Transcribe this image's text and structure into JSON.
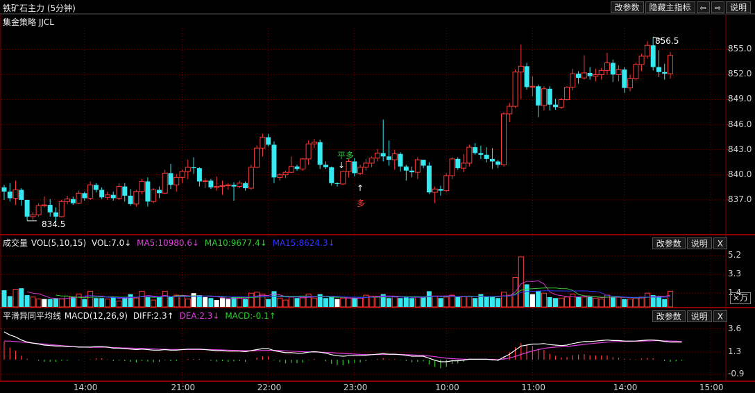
{
  "header": {
    "title": "铁矿石主力 (5分钟)",
    "buttons": {
      "params": "改参数",
      "hide_main": "隐藏主指标",
      "prev": "⇦",
      "next": "⇨",
      "help": "说明"
    }
  },
  "strategy": {
    "label": "集金策略 JJCL"
  },
  "colors": {
    "up": "#ff3b3b",
    "down": "#36e8f0",
    "grid": "#7a0000",
    "ma5": "#ffffff",
    "ma10": "#ffd700",
    "ma15": "#cc33cc",
    "ma_vol10": "#33cc33",
    "ma_vol15": "#3333ff"
  },
  "price_axis": {
    "ticks": [
      "855.0",
      "852.0",
      "849.0",
      "846.0",
      "843.0",
      "840.0",
      "837.0"
    ],
    "tick_values": [
      855,
      852,
      849,
      846,
      843,
      840,
      837
    ],
    "range": [
      833.0,
      857.6
    ]
  },
  "annotations": {
    "high": "856.5",
    "low": "834.5",
    "close_long": "平多",
    "long": "多",
    "arrow_down": "↓",
    "arrow_up": "↑"
  },
  "volume_panel": {
    "title": "成交量",
    "label": "VOL(5,10,15)",
    "vol": "VOL:7.0↓",
    "ma5": "MA5:10980.6↓",
    "ma10": "MA10:9677.4↓",
    "ma15": "MA15:8624.3↓",
    "buttons": {
      "params": "改参数",
      "help": "说明",
      "close": "X"
    },
    "ticks": [
      "5.2",
      "3.3",
      "1.4"
    ],
    "tick_values": [
      5.2,
      3.3,
      1.4
    ],
    "range": [
      0,
      5.8
    ],
    "unit": "×万"
  },
  "macd_panel": {
    "title": "平滑异同平均线",
    "label": "MACD(12,26,9)",
    "diff": "DIFF:2.3↑",
    "dea": "DEA:2.3↓",
    "macd": "MACD:-0.1↑",
    "buttons": {
      "params": "改参数",
      "help": "说明",
      "close": "X"
    },
    "ticks": [
      "3.6",
      "1.3",
      "-0.9"
    ],
    "tick_values": [
      3.6,
      1.3,
      -0.9
    ],
    "range": [
      -1.5,
      4.4
    ]
  },
  "time_axis": {
    "labels": [
      "14:00",
      "21:00",
      "22:00",
      "23:00",
      "10:00",
      "11:00",
      "14:00",
      "15:00"
    ],
    "label_index": [
      14,
      31,
      46,
      61,
      77,
      92,
      108,
      123
    ]
  },
  "chart_data": {
    "type": "candlestick",
    "candles": [
      [
        838.5,
        838.8,
        837.0,
        838.0
      ],
      [
        838.0,
        839.0,
        836.8,
        837.2
      ],
      [
        837.2,
        839.3,
        836.4,
        838.2
      ],
      [
        838.2,
        838.4,
        836.3,
        837.0
      ],
      [
        837.0,
        837.0,
        834.5,
        835.0
      ],
      [
        835.0,
        835.5,
        834.6,
        835.2
      ],
      [
        835.2,
        836.6,
        835.0,
        836.3
      ],
      [
        836.3,
        837.4,
        836.1,
        836.4
      ],
      [
        836.4,
        837.1,
        835.0,
        835.5
      ],
      [
        835.5,
        836.1,
        834.5,
        835.0
      ],
      [
        835.0,
        837.0,
        834.9,
        836.8
      ],
      [
        836.8,
        837.5,
        836.5,
        837.1
      ],
      [
        837.1,
        837.4,
        836.4,
        836.6
      ],
      [
        836.6,
        838.1,
        836.5,
        837.8
      ],
      [
        837.8,
        838.0,
        836.9,
        837.2
      ],
      [
        837.2,
        839.2,
        837.0,
        838.8
      ],
      [
        838.8,
        839.0,
        837.9,
        838.2
      ],
      [
        838.2,
        838.5,
        837.1,
        837.3
      ],
      [
        837.3,
        838.0,
        837.0,
        837.6
      ],
      [
        837.6,
        838.0,
        836.9,
        837.2
      ],
      [
        837.2,
        839.0,
        837.0,
        838.6
      ],
      [
        838.6,
        839.0,
        836.8,
        837.5
      ],
      [
        837.5,
        838.3,
        836.3,
        836.5
      ],
      [
        836.5,
        838.2,
        836.2,
        838.0
      ],
      [
        838.0,
        839.5,
        837.7,
        839.2
      ],
      [
        839.2,
        839.7,
        836.2,
        836.8
      ],
      [
        836.8,
        838.4,
        836.6,
        838.2
      ],
      [
        838.2,
        838.6,
        837.2,
        837.8
      ],
      [
        837.8,
        840.6,
        837.8,
        840.2
      ],
      [
        840.2,
        841.3,
        838.3,
        838.8
      ],
      [
        838.8,
        840.1,
        838.0,
        839.7
      ],
      [
        839.7,
        840.6,
        839.0,
        840.4
      ],
      [
        840.4,
        841.8,
        839.5,
        840.9
      ],
      [
        840.9,
        842.1,
        840.1,
        840.8
      ],
      [
        840.8,
        840.9,
        838.6,
        839.2
      ],
      [
        839.2,
        839.6,
        838.4,
        839.3
      ],
      [
        839.3,
        839.5,
        838.3,
        838.5
      ],
      [
        838.5,
        839.8,
        838.1,
        838.6
      ],
      [
        838.6,
        839.3,
        837.6,
        838.7
      ],
      [
        838.7,
        839.0,
        838.2,
        838.8
      ],
      [
        838.8,
        839.1,
        836.9,
        838.6
      ],
      [
        838.6,
        839.3,
        838.4,
        839.0
      ],
      [
        839.0,
        839.2,
        838.1,
        838.4
      ],
      [
        838.4,
        841.2,
        838.2,
        840.9
      ],
      [
        840.9,
        843.5,
        840.8,
        843.2
      ],
      [
        843.2,
        844.9,
        842.2,
        844.5
      ],
      [
        844.5,
        844.9,
        843.4,
        843.6
      ],
      [
        843.6,
        844.0,
        839.0,
        839.7
      ],
      [
        839.7,
        840.2,
        839.3,
        840.0
      ],
      [
        840.0,
        840.5,
        839.6,
        840.3
      ],
      [
        840.3,
        842.2,
        840.2,
        841.0
      ],
      [
        841.0,
        841.2,
        840.5,
        840.7
      ],
      [
        840.7,
        842.0,
        840.5,
        841.9
      ],
      [
        841.9,
        844.1,
        841.2,
        843.7
      ],
      [
        843.7,
        844.3,
        843.2,
        843.9
      ],
      [
        843.9,
        844.2,
        840.7,
        841.2
      ],
      [
        841.2,
        841.6,
        840.7,
        840.9
      ],
      [
        840.9,
        841.0,
        838.7,
        839.0
      ],
      [
        839.0,
        839.1,
        838.6,
        838.9
      ],
      [
        838.9,
        840.5,
        838.8,
        840.4
      ],
      [
        840.4,
        841.9,
        839.7,
        841.6
      ],
      [
        841.6,
        842.0,
        839.8,
        840.2
      ],
      [
        840.2,
        841.2,
        840.0,
        840.9
      ],
      [
        840.9,
        841.9,
        840.5,
        841.4
      ],
      [
        841.4,
        842.2,
        840.9,
        842.0
      ],
      [
        842.0,
        843.1,
        841.6,
        842.6
      ],
      [
        842.6,
        846.6,
        841.6,
        842.2
      ],
      [
        842.2,
        844.1,
        841.1,
        841.8
      ],
      [
        841.8,
        843.0,
        840.6,
        842.5
      ],
      [
        842.5,
        842.7,
        840.4,
        841.0
      ],
      [
        841.0,
        841.2,
        839.3,
        840.5
      ],
      [
        840.5,
        841.0,
        839.7,
        840.3
      ],
      [
        840.3,
        842.1,
        839.5,
        841.8
      ],
      [
        841.8,
        841.8,
        840.8,
        841.1
      ],
      [
        841.1,
        841.5,
        837.7,
        837.9
      ],
      [
        837.9,
        838.6,
        836.6,
        838.3
      ],
      [
        838.3,
        838.7,
        837.5,
        838.1
      ],
      [
        838.1,
        840.2,
        838.0,
        839.9
      ],
      [
        839.9,
        842.1,
        839.5,
        841.9
      ],
      [
        841.9,
        842.1,
        840.6,
        840.8
      ],
      [
        840.8,
        842.5,
        840.3,
        841.4
      ],
      [
        841.4,
        843.6,
        841.0,
        843.3
      ],
      [
        843.3,
        843.8,
        842.4,
        842.6
      ],
      [
        842.6,
        843.5,
        841.9,
        842.4
      ],
      [
        842.4,
        843.3,
        841.5,
        841.9
      ],
      [
        841.9,
        843.2,
        840.7,
        841.6
      ],
      [
        841.6,
        841.8,
        840.8,
        841.2
      ],
      [
        841.2,
        847.5,
        841.0,
        847.3
      ],
      [
        847.3,
        848.6,
        846.3,
        848.2
      ],
      [
        848.2,
        852.6,
        848.0,
        852.3
      ],
      [
        852.3,
        855.6,
        849.1,
        853.0
      ],
      [
        853.0,
        853.4,
        850.2,
        850.5
      ],
      [
        850.5,
        851.8,
        849.4,
        850.6
      ],
      [
        850.6,
        850.8,
        846.9,
        848.3
      ],
      [
        848.3,
        850.6,
        847.7,
        850.3
      ],
      [
        850.3,
        850.6,
        847.7,
        848.4
      ],
      [
        848.4,
        849.1,
        847.8,
        848.1
      ],
      [
        848.1,
        849.2,
        847.9,
        849.0
      ],
      [
        849.0,
        850.6,
        848.9,
        850.5
      ],
      [
        850.5,
        852.7,
        850.1,
        852.1
      ],
      [
        852.1,
        852.4,
        850.9,
        851.6
      ],
      [
        851.6,
        854.3,
        851.4,
        852.2
      ],
      [
        852.2,
        852.9,
        851.4,
        851.8
      ],
      [
        851.8,
        852.7,
        851.2,
        852.0
      ],
      [
        852.0,
        852.8,
        851.4,
        852.5
      ],
      [
        852.5,
        854.6,
        852.0,
        853.4
      ],
      [
        853.4,
        853.8,
        851.1,
        852.0
      ],
      [
        852.0,
        853.1,
        851.2,
        852.6
      ],
      [
        852.6,
        852.9,
        849.8,
        850.4
      ],
      [
        850.4,
        852.0,
        850.0,
        851.5
      ],
      [
        851.5,
        853.4,
        851.3,
        853.2
      ],
      [
        853.2,
        854.5,
        852.4,
        854.2
      ],
      [
        854.2,
        856.0,
        853.9,
        855.5
      ],
      [
        855.5,
        856.5,
        852.5,
        852.9
      ],
      [
        852.9,
        854.9,
        851.7,
        852.3
      ],
      [
        852.3,
        853.3,
        851.4,
        852.1
      ],
      [
        852.1,
        854.7,
        851.5,
        854.3
      ]
    ],
    "volume": [
      1.7,
      1.1,
      1.8,
      1.9,
      1.2,
      1.0,
      0.8,
      0.8,
      0.8,
      0.9,
      0.8,
      1.1,
      1.0,
      1.3,
      0.8,
      1.6,
      0.9,
      0.9,
      0.8,
      1.0,
      0.6,
      1.0,
      1.3,
      0.9,
      1.6,
      1.0,
      0.7,
      1.0,
      1.6,
      1.0,
      1.2,
      1.1,
      0.8,
      1.4,
      1.2,
      1.0,
      0.9,
      0.7,
      0.9,
      0.8,
      1.0,
      0.9,
      0.8,
      1.4,
      1.5,
      1.3,
      0.8,
      1.6,
      0.9,
      0.7,
      1.0,
      0.9,
      1.0,
      1.3,
      0.9,
      1.3,
      0.9,
      1.0,
      0.8,
      0.9,
      0.9,
      0.9,
      0.9,
      1.2,
      1.1,
      1.1,
      1.3,
      0.9,
      1.1,
      0.9,
      1.0,
      0.9,
      1.0,
      1.0,
      1.6,
      1.1,
      0.9,
      1.0,
      1.2,
      1.0,
      1.1,
      1.1,
      0.9,
      1.3,
      1.0,
      1.0,
      0.9,
      1.5,
      1.2,
      3.0,
      5.1,
      2.3,
      1.3,
      1.6,
      1.4,
      1.0,
      0.9,
      0.9,
      1.0,
      1.3,
      1.0,
      1.0,
      1.0,
      0.9,
      0.8,
      1.2,
      1.0,
      1.0,
      0.8,
      0.8,
      0.9,
      1.0,
      1.4,
      1.2,
      1.0,
      0.8,
      1.6
    ],
    "macd": {
      "diff": [
        3.3,
        3.0,
        2.8,
        2.5,
        2.3,
        2.2,
        2.1,
        2.0,
        1.95,
        1.9,
        1.9,
        1.85,
        1.85,
        1.8,
        1.8,
        1.8,
        1.85,
        1.85,
        1.8,
        1.7,
        1.7,
        1.65,
        1.6,
        1.55,
        1.6,
        1.55,
        1.5,
        1.5,
        1.55,
        1.5,
        1.5,
        1.55,
        1.6,
        1.6,
        1.6,
        1.55,
        1.5,
        1.45,
        1.45,
        1.4,
        1.4,
        1.4,
        1.35,
        1.45,
        1.55,
        1.65,
        1.65,
        1.45,
        1.35,
        1.25,
        1.25,
        1.2,
        1.2,
        1.3,
        1.35,
        1.3,
        1.2,
        1.05,
        0.95,
        0.9,
        0.95,
        0.95,
        0.95,
        1.0,
        1.05,
        1.1,
        1.15,
        1.1,
        1.1,
        1.05,
        1.0,
        0.9,
        0.9,
        0.9,
        0.7,
        0.5,
        0.35,
        0.35,
        0.45,
        0.45,
        0.5,
        0.6,
        0.6,
        0.6,
        0.6,
        0.55,
        0.5,
        0.8,
        1.1,
        1.5,
        1.9,
        2.0,
        2.1,
        2.1,
        2.15,
        2.05,
        2.0,
        1.95,
        2.0,
        2.15,
        2.25,
        2.35,
        2.35,
        2.4,
        2.45,
        2.5,
        2.45,
        2.45,
        2.4,
        2.4,
        2.4,
        2.45,
        2.5,
        2.5,
        2.45,
        2.35,
        2.3,
        2.3,
        2.3
      ],
      "dea": [
        2.4,
        2.4,
        2.35,
        2.3,
        2.25,
        2.2,
        2.15,
        2.1,
        2.05,
        2.0,
        1.95,
        1.9,
        1.85,
        1.82,
        1.8,
        1.78,
        1.78,
        1.78,
        1.78,
        1.76,
        1.74,
        1.72,
        1.7,
        1.68,
        1.66,
        1.64,
        1.62,
        1.6,
        1.58,
        1.57,
        1.56,
        1.56,
        1.56,
        1.56,
        1.56,
        1.56,
        1.55,
        1.54,
        1.52,
        1.5,
        1.48,
        1.46,
        1.45,
        1.44,
        1.45,
        1.47,
        1.48,
        1.48,
        1.46,
        1.43,
        1.4,
        1.37,
        1.34,
        1.32,
        1.31,
        1.3,
        1.28,
        1.25,
        1.21,
        1.17,
        1.14,
        1.11,
        1.08,
        1.07,
        1.06,
        1.06,
        1.07,
        1.07,
        1.07,
        1.07,
        1.06,
        1.03,
        1.0,
        0.98,
        0.93,
        0.85,
        0.77,
        0.7,
        0.66,
        0.63,
        0.6,
        0.6,
        0.6,
        0.6,
        0.6,
        0.59,
        0.57,
        0.62,
        0.72,
        0.88,
        1.08,
        1.26,
        1.42,
        1.55,
        1.67,
        1.75,
        1.8,
        1.83,
        1.87,
        1.93,
        2.0,
        2.07,
        2.13,
        2.19,
        2.24,
        2.29,
        2.32,
        2.35,
        2.36,
        2.37,
        2.38,
        2.39,
        2.41,
        2.43,
        2.44,
        2.42,
        2.4,
        2.38,
        2.35
      ]
    }
  }
}
